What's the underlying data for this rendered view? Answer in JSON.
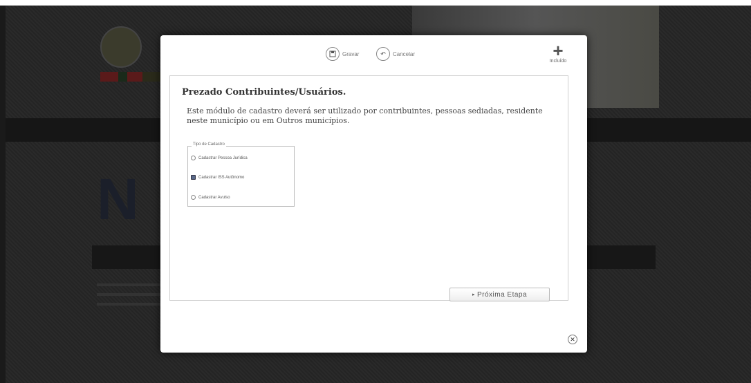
{
  "toolbar": {
    "save_label": "Gravar",
    "cancel_label": "Cancelar",
    "new_label": "Incluído",
    "save_icon": "floppy-icon",
    "cancel_icon": "undo-icon",
    "new_icon": "plus-icon"
  },
  "panel": {
    "title": "Prezado Contribuintes/Usuários.",
    "description": "Este módulo de cadastro deverá ser utilizado por contribuintes, pessoas sediadas, residente neste município ou em Outros municípios.",
    "fieldset_legend": "Tipo de Cadastro",
    "options": [
      {
        "label": "Cadastrar Pessoa Jurídica",
        "checked": false
      },
      {
        "label": "Cadastrar ISS Autônomo",
        "checked": true
      },
      {
        "label": "Cadastrar Avulso",
        "checked": false
      }
    ],
    "next_label": "Próxima Etapa",
    "next_icon": "triangle-right-icon"
  },
  "close": {
    "icon": "close-icon"
  }
}
